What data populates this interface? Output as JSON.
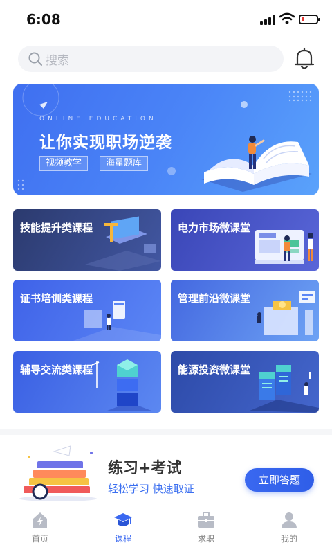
{
  "status_bar": {
    "time": "6:08"
  },
  "search": {
    "placeholder": "搜索",
    "icon": "search-icon"
  },
  "header": {
    "bell_icon": "bell-icon"
  },
  "banner": {
    "eyebrow": "ONLINE EDUCATION",
    "title": "让你实现职场逆袭",
    "tags": [
      "视频教学",
      "海量题库"
    ]
  },
  "courses": [
    {
      "label": "技能提升类课程"
    },
    {
      "label": "电力市场微课堂"
    },
    {
      "label": "证书培训类课程"
    },
    {
      "label": "管理前沿微课堂"
    },
    {
      "label": "辅导交流类课程"
    },
    {
      "label": "能源投资微课堂"
    }
  ],
  "promo": {
    "title": "练习+考试",
    "subtitle": "轻松学习  快速取证",
    "button_label": "立即答题"
  },
  "tabbar": {
    "active": 1,
    "tabs": [
      {
        "label": "首页",
        "icon": "home-icon"
      },
      {
        "label": "课程",
        "icon": "graduation-cap-icon"
      },
      {
        "label": "求职",
        "icon": "briefcase-icon"
      },
      {
        "label": "我的",
        "icon": "person-icon"
      }
    ]
  },
  "colors": {
    "accent": "#3a68f0",
    "inactive": "#888888"
  }
}
